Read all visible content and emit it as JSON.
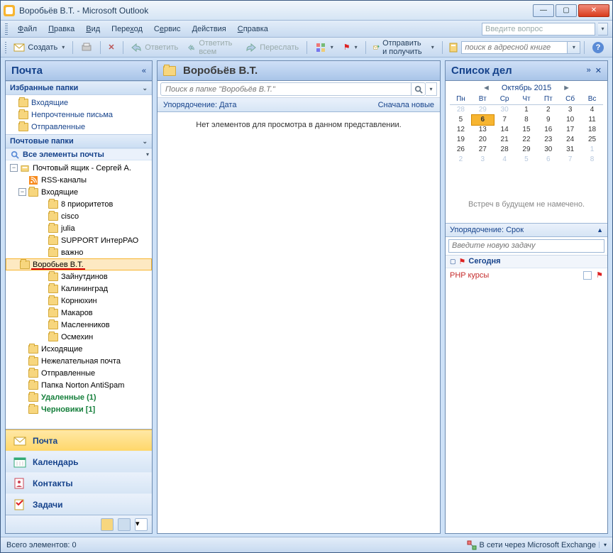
{
  "window": {
    "title": "Воробьёв В.Т. - Microsoft Outlook"
  },
  "menu": {
    "file": "Файл",
    "edit": "Правка",
    "view": "Вид",
    "go": "Переход",
    "tools": "Сервис",
    "actions": "Действия",
    "help": "Справка",
    "question_ph": "Введите вопрос"
  },
  "toolbar": {
    "new": "Создать",
    "reply": "Ответить",
    "replyall": "Ответить всем",
    "forward": "Переслать",
    "sendreceive": "Отправить и получить",
    "addr_ph": "поиск в адресной книге"
  },
  "left": {
    "header": "Почта",
    "fav_header": "Избранные папки",
    "fav": [
      "Входящие",
      "Непрочтенные письма",
      "Отправленные"
    ],
    "mail_header": "Почтовые папки",
    "allitems": "Все элементы почты",
    "root": "Почтовый ящик - Сергей А.",
    "rss": "RSS-каналы",
    "inbox": "Входящие",
    "sub": [
      "8 приоритетов",
      "cisco",
      "julia",
      "SUPPORT ИнтерРАО",
      "важно",
      "Воробьев В.Т.",
      "Зайнутдинов",
      "Калининград",
      "Корнюхин",
      "Макаров",
      "Масленников",
      "Осмехин"
    ],
    "other": [
      {
        "l": "Исходящие",
        "b": false
      },
      {
        "l": "Нежелательная почта",
        "b": false
      },
      {
        "l": "Отправленные",
        "b": false
      },
      {
        "l": "Папка Norton AntiSpam",
        "b": false
      },
      {
        "l": "Удаленные (1)",
        "b": true
      },
      {
        "l": "Черновики [1]",
        "b": true
      }
    ],
    "nav": [
      "Почта",
      "Календарь",
      "Контакты",
      "Задачи"
    ]
  },
  "mid": {
    "title": "Воробьёв В.Т.",
    "search_ph": "Поиск в папке \"Воробьёв В.Т.\"",
    "sort_l": "Упорядочение: Дата",
    "sort_r": "Сначала новые",
    "empty": "Нет элементов для просмотра в данном представлении."
  },
  "right": {
    "header": "Список дел",
    "month": "Октябрь 2015",
    "dow": [
      "Пн",
      "Вт",
      "Ср",
      "Чт",
      "Пт",
      "Сб",
      "Вс"
    ],
    "grid": [
      [
        {
          "d": 28,
          "dim": 1
        },
        {
          "d": 29,
          "dim": 1
        },
        {
          "d": 30,
          "dim": 1
        },
        {
          "d": 1
        },
        {
          "d": 2
        },
        {
          "d": 3
        },
        {
          "d": 4
        }
      ],
      [
        {
          "d": 5
        },
        {
          "d": 6,
          "today": 1
        },
        {
          "d": 7
        },
        {
          "d": 8
        },
        {
          "d": 9
        },
        {
          "d": 10
        },
        {
          "d": 11
        }
      ],
      [
        {
          "d": 12
        },
        {
          "d": 13
        },
        {
          "d": 14
        },
        {
          "d": 15
        },
        {
          "d": 16
        },
        {
          "d": 17
        },
        {
          "d": 18
        }
      ],
      [
        {
          "d": 19
        },
        {
          "d": 20
        },
        {
          "d": 21
        },
        {
          "d": 22
        },
        {
          "d": 23
        },
        {
          "d": 24
        },
        {
          "d": 25
        }
      ],
      [
        {
          "d": 26
        },
        {
          "d": 27
        },
        {
          "d": 28
        },
        {
          "d": 29
        },
        {
          "d": 30
        },
        {
          "d": 31
        },
        {
          "d": 1,
          "dim": 1
        }
      ],
      [
        {
          "d": 2,
          "dim": 1
        },
        {
          "d": 3,
          "dim": 1
        },
        {
          "d": 4,
          "dim": 1
        },
        {
          "d": 5,
          "dim": 1
        },
        {
          "d": 6,
          "dim": 1
        },
        {
          "d": 7,
          "dim": 1
        },
        {
          "d": 8,
          "dim": 1
        }
      ]
    ],
    "noapt": "Встреч в будущем не намечено.",
    "task_sort": "Упорядочение: Срок",
    "task_ph": "Введите новую задачу",
    "task_group": "Сегодня",
    "task1": "PHP курсы"
  },
  "status": {
    "left": "Всего элементов: 0",
    "right": "В сети через Microsoft Exchange"
  }
}
